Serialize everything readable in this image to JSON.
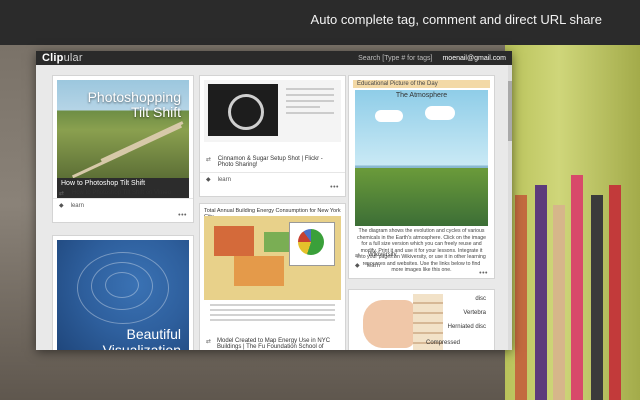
{
  "tagline": "Auto complete tag, comment and direct URL share",
  "app": {
    "logo_bold": "Clip",
    "logo_light": "ular",
    "search_placeholder": "Search [Type # for tags]",
    "user_email": "moenail@gmail.com"
  },
  "cards": [
    {
      "image_title_line1": "Photoshopping",
      "image_title_line2": "Tilt Shift",
      "video_title": "How to Photoshop Tilt Shift",
      "title": "How to Photoshop Tilt Shift on Vimeo",
      "tag": "learn",
      "more": "•••"
    },
    {
      "title": "Cinnamon & Sugar Setup Shot | Flickr - Photo Sharing!",
      "tag": "learn",
      "more": "•••"
    },
    {
      "header": "Educational Picture of the Day",
      "image_label": "The Atmosphere",
      "description": "The diagram shows the evolution and cycles of various chemicals in the Earth's atmosphere. Click on the image for a full size version which you can freely reuse and modify. Print it and use it for your lessons. Integrate it into your pages on Wikiversity, or use it in other learning resources and websites. Use the links below to find more images like this one.",
      "title": "Wikiversity",
      "tag": "learn",
      "more": "•••"
    },
    {
      "image_title_line1": "Beautiful",
      "image_title_line2": "Visualization"
    },
    {
      "header": "Total Annual Building Energy Consumption for New York City",
      "title": "Model Created to Map Energy Use in NYC Buildings | The Fu Foundation School of Engineering & Applied"
    },
    {
      "labels": [
        "disc",
        "Vertebra",
        "Herniated disc",
        "Compressed"
      ]
    }
  ],
  "icons": {
    "link": "link-icon",
    "tag": "tag-icon",
    "more": "more-icon"
  }
}
